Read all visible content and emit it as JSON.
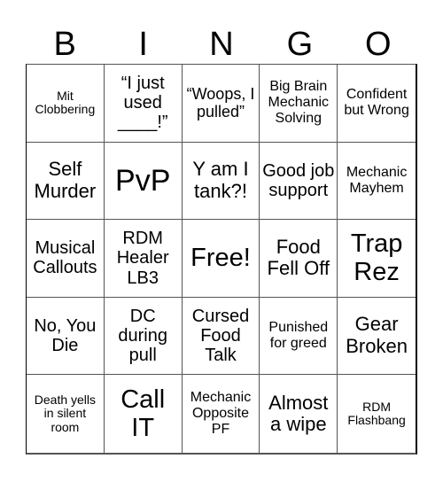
{
  "header": {
    "letters": [
      "B",
      "I",
      "N",
      "G",
      "O"
    ]
  },
  "cells": [
    "Mit Clobbering",
    "“I just used ____!”",
    "“Woops, I pulled”",
    "Big Brain Mechanic Solving",
    "Confident but Wrong",
    "Self Murder",
    "PvP",
    "Y am I tank?!",
    "Good job support",
    "Mechanic Mayhem",
    "Musical Callouts",
    "RDM Healer LB3",
    "Free!",
    "Food Fell Off",
    "Trap Rez",
    "No, You Die",
    "DC during pull",
    "Cursed Food Talk",
    "Punished for greed",
    "Gear Broken",
    "Death yells in silent room",
    "Call IT",
    "Mechanic Opposite PF",
    "Almost a wipe",
    "RDM Flashbang"
  ]
}
